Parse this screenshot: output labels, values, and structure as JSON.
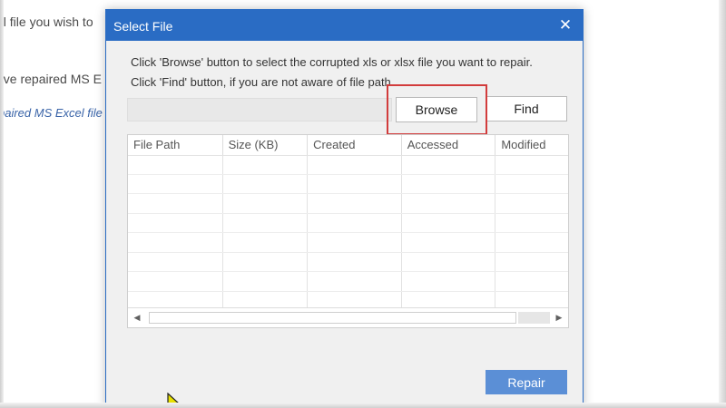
{
  "background": {
    "line1": "el file you wish to",
    "line2": "ave repaired MS E",
    "line3": "paired MS Excel file"
  },
  "dialog": {
    "title": "Select File",
    "close_symbol": "✕",
    "instruction1": "Click 'Browse' button to select the corrupted xls or xlsx file you want to repair.",
    "instruction2": "Click 'Find' button, if you are not aware of file path.",
    "path_value": "",
    "browse_label": "Browse",
    "find_label": "Find",
    "repair_label": "Repair",
    "highlight_color": "#d23c3c",
    "accent_color": "#2a6cc4"
  },
  "table": {
    "columns": [
      "File Path",
      "Size (KB)",
      "Created",
      "Accessed",
      "Modified"
    ],
    "rows": []
  },
  "icons": {
    "close": "close-icon",
    "scroll_left": "arrow-left-icon",
    "scroll_right": "arrow-right-icon",
    "cursor": "mouse-cursor-icon"
  }
}
